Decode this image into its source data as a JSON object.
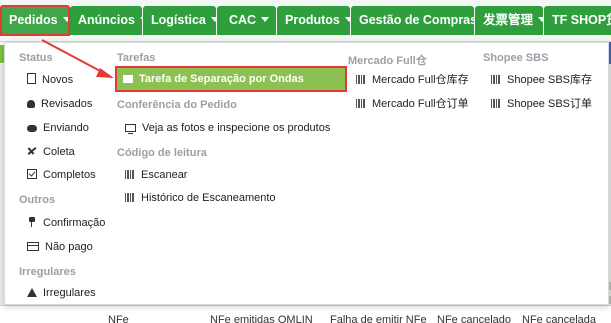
{
  "nav": {
    "items": [
      {
        "label": "Pedidos",
        "active": true
      },
      {
        "label": "Anúncios"
      },
      {
        "label": "Logística"
      },
      {
        "label": "CAC"
      },
      {
        "label": "Produtos"
      },
      {
        "label": "Gestão de Compras"
      },
      {
        "label": "发票管理"
      },
      {
        "label": "TF SHOP货源"
      }
    ]
  },
  "menu": {
    "status": {
      "title": "Status",
      "items": [
        {
          "label": "Novos",
          "icon": "document-icon"
        },
        {
          "label": "Revisados",
          "icon": "review-icon"
        },
        {
          "label": "Enviando",
          "icon": "truck-icon"
        },
        {
          "label": "Coleta",
          "icon": "plane-icon"
        },
        {
          "label": "Completos",
          "icon": "checkbox-icon"
        }
      ]
    },
    "outros": {
      "title": "Outros",
      "items": [
        {
          "label": "Confirmação",
          "icon": "pin-icon"
        },
        {
          "label": "Não pago",
          "icon": "card-icon"
        }
      ]
    },
    "irregulares": {
      "title": "Irregulares",
      "items": [
        {
          "label": "Irregulares",
          "icon": "warning-icon"
        }
      ]
    },
    "tarefas": {
      "title": "Tarefas",
      "items": [
        {
          "label": "Tarefa de Separação por Ondas",
          "icon": "list-icon",
          "highlighted": true
        }
      ]
    },
    "conferencia": {
      "title": "Conferência do Pedido",
      "items": [
        {
          "label": "Veja as fotos e inspecione os produtos",
          "icon": "monitor-icon"
        }
      ]
    },
    "codigo": {
      "title": "Código de leitura",
      "items": [
        {
          "label": "Escanear",
          "icon": "barcode-icon"
        },
        {
          "label": "Histórico de Escaneamento",
          "icon": "barcode-icon"
        }
      ]
    },
    "mercado_full": {
      "title": "Mercado Full仓",
      "items": [
        {
          "label": "Mercado Full仓库存",
          "icon": "barcode-icon"
        },
        {
          "label": "Mercado Full仓订单",
          "icon": "barcode-icon"
        }
      ]
    },
    "shopee_sbs": {
      "title": "Shopee SBS",
      "items": [
        {
          "label": "Shopee SBS库存",
          "icon": "barcode-icon"
        },
        {
          "label": "Shopee SBS订单",
          "icon": "barcode-icon"
        }
      ]
    }
  },
  "background_row": {
    "cells": [
      "NFe",
      "NFe emitidas OMLIN",
      "Falha de emitir NFe",
      "NFe cancelado",
      "NFe cancelada"
    ]
  },
  "colors": {
    "nav_green": "#2f9e3d",
    "highlight_green": "#8cc152",
    "annotation_red": "#e53935"
  }
}
